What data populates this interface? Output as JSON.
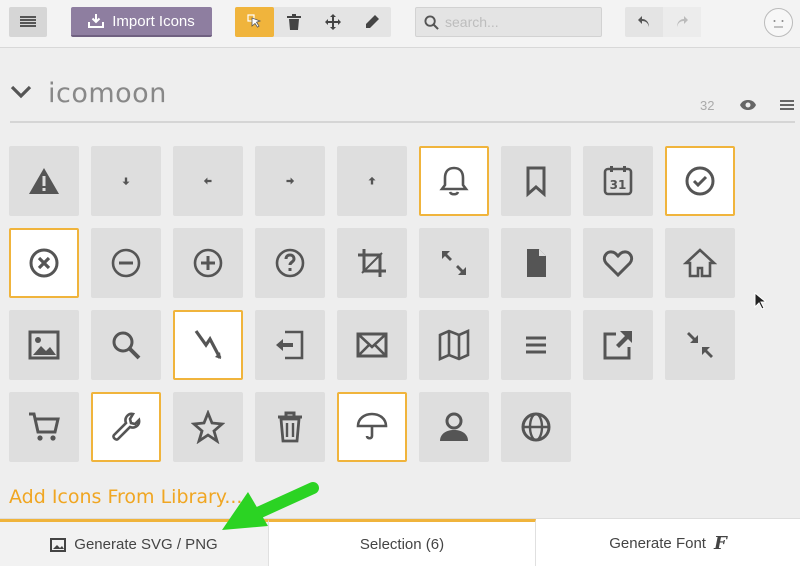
{
  "toolbar": {
    "import_label": "Import Icons",
    "search_placeholder": "search...",
    "menu_icon": "hamburger-icon",
    "tools": [
      "select-icon",
      "trash-icon",
      "move-icon",
      "pencil-icon"
    ],
    "undo_icon": "undo-icon",
    "redo_icon": "redo-icon",
    "accent_color": "#f0b43c",
    "import_color": "#8e7ea0"
  },
  "set": {
    "name": "icomoon",
    "count": "32"
  },
  "icons": [
    {
      "name": "warning-icon",
      "selected": false
    },
    {
      "name": "arrow-down-icon",
      "selected": false
    },
    {
      "name": "arrow-left-icon",
      "selected": false
    },
    {
      "name": "arrow-right-icon",
      "selected": false
    },
    {
      "name": "arrow-up-icon",
      "selected": false
    },
    {
      "name": "bell-icon",
      "selected": true
    },
    {
      "name": "bookmark-icon",
      "selected": false
    },
    {
      "name": "calendar-icon",
      "selected": false
    },
    {
      "name": "checkmark-circle-icon",
      "selected": true
    },
    {
      "name": "close-circle-icon",
      "selected": true
    },
    {
      "name": "minus-circle-icon",
      "selected": false
    },
    {
      "name": "plus-circle-icon",
      "selected": false
    },
    {
      "name": "question-circle-icon",
      "selected": false
    },
    {
      "name": "crop-icon",
      "selected": false
    },
    {
      "name": "expand-icon",
      "selected": false
    },
    {
      "name": "file-icon",
      "selected": false
    },
    {
      "name": "heart-icon",
      "selected": false
    },
    {
      "name": "home-icon",
      "selected": false
    },
    {
      "name": "image-icon",
      "selected": false
    },
    {
      "name": "search-icon",
      "selected": false
    },
    {
      "name": "lightning-icon",
      "selected": true
    },
    {
      "name": "login-icon",
      "selected": false
    },
    {
      "name": "mail-icon",
      "selected": false
    },
    {
      "name": "map-icon",
      "selected": false
    },
    {
      "name": "menu-icon",
      "selected": false
    },
    {
      "name": "external-link-icon",
      "selected": false
    },
    {
      "name": "shrink-icon",
      "selected": false
    },
    {
      "name": "cart-icon",
      "selected": false
    },
    {
      "name": "wrench-icon",
      "selected": true
    },
    {
      "name": "star-icon",
      "selected": false
    },
    {
      "name": "trash-can-icon",
      "selected": false
    },
    {
      "name": "umbrella-icon",
      "selected": true
    },
    {
      "name": "user-icon",
      "selected": false
    },
    {
      "name": "globe-icon",
      "selected": false
    }
  ],
  "add_library_label": "Add Icons From Library...",
  "bottom_bar": {
    "generate_svg_label": "Generate SVG / PNG",
    "selection_label": "Selection (6)",
    "generate_font_label": "Generate Font",
    "font_glyph": "F"
  }
}
